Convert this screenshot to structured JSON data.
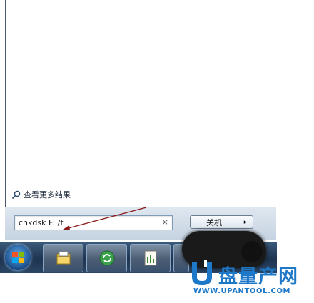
{
  "start_menu": {
    "see_more_results": "查看更多结果",
    "search": {
      "value": "chkdsk F: /f"
    },
    "clear_symbol": "×",
    "shutdown": {
      "label": "关机",
      "arrow": "▸"
    }
  },
  "taskbar": {
    "start_icon": "windows-orb-icon",
    "pinned": [
      {
        "icon": "library-folder-icon"
      },
      {
        "icon": "refresh-circle-icon"
      },
      {
        "icon": "document-chart-icon"
      }
    ]
  },
  "watermark": {
    "brand_cn": "盘量产网",
    "url": "WWW.UPANTOOL.COM",
    "color": "#1e78c8"
  },
  "colors": {
    "annotation_arrow": "#8b1a1a",
    "taskbar": "#1e3450"
  }
}
